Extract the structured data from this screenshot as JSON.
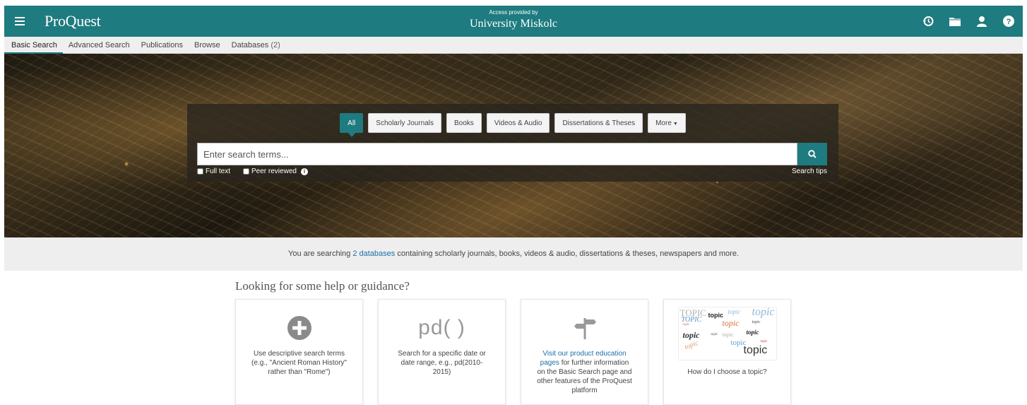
{
  "header": {
    "logo": "ProQuest",
    "access_small": "Access provided by",
    "access_univ": "University Miskolc",
    "icons": [
      "history-icon",
      "folder-icon",
      "user-icon",
      "help-icon"
    ]
  },
  "nav": {
    "items": [
      {
        "label": "Basic Search"
      },
      {
        "label": "Advanced Search"
      },
      {
        "label": "Publications"
      },
      {
        "label": "Browse"
      },
      {
        "label": "Databases",
        "count": "(2)"
      }
    ]
  },
  "search": {
    "tabs": [
      {
        "label": "All"
      },
      {
        "label": "Scholarly Journals"
      },
      {
        "label": "Books"
      },
      {
        "label": "Videos & Audio"
      },
      {
        "label": "Dissertations & Theses"
      },
      {
        "label": "More"
      }
    ],
    "placeholder": "Enter search terms...",
    "full_text": "Full text",
    "peer_reviewed": "Peer reviewed",
    "tips": "Search tips"
  },
  "banner": {
    "prefix": "You are searching",
    "link": "2 databases",
    "suffix": "containing scholarly journals, books, videos & audio, dissertations & theses, newspapers and more."
  },
  "help": {
    "title": "Looking for some help or guidance?",
    "cards": [
      {
        "text": "Use descriptive search terms (e.g., \"Ancient Roman History\" rather than \"Rome\")"
      },
      {
        "glyph": "pd( )",
        "text": "Search for a specific date or date range, e.g., pd(2010-2015)"
      },
      {
        "link": "Visit our product education pages",
        "text": "for further information on the Basic Search page and other features of the ProQuest platform"
      },
      {
        "text": "How do I choose a topic?"
      }
    ],
    "topic_words": [
      "TOPIC",
      "topic",
      "topic",
      "topic",
      "TOPIC",
      "topic",
      "topic",
      "topic",
      "topic",
      "topic",
      "topic",
      "topic",
      "topic",
      "topic",
      "topic",
      "topic"
    ]
  },
  "colors": {
    "brand": "#1e7b7f",
    "link": "#1e6fa8"
  }
}
